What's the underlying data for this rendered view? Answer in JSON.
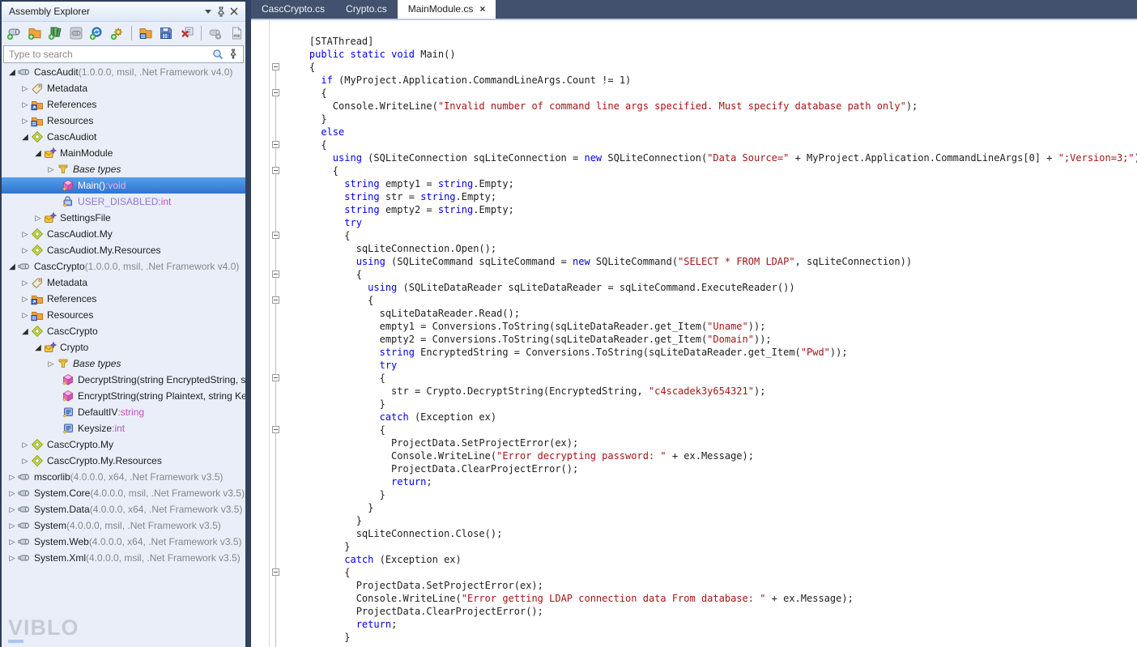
{
  "explorer": {
    "title": "Assembly Explorer",
    "title_buttons": [
      {
        "name": "panel-menu-button",
        "icon": "chevron-down-icon"
      },
      {
        "name": "panel-pin-button",
        "icon": "pin-icon"
      },
      {
        "name": "panel-close-button",
        "icon": "close-icon"
      }
    ],
    "toolbar": [
      {
        "name": "open-assembly-button",
        "icon": "assembly-add-icon"
      },
      {
        "name": "open-folder-button",
        "icon": "folder-add-icon"
      },
      {
        "name": "open-list-button",
        "icon": "list-add-icon"
      },
      {
        "name": "open-from-gac-button",
        "icon": "gac-icon"
      },
      {
        "name": "reload-assemblies-button",
        "icon": "reload-add-icon"
      },
      {
        "name": "open-dynamic-button",
        "icon": "gear-add-icon"
      },
      {
        "sep": true
      },
      {
        "name": "open-module-button",
        "icon": "module-folder-icon"
      },
      {
        "name": "save-module-button",
        "icon": "save-module-icon"
      },
      {
        "name": "close-file-button",
        "icon": "close-file-icon"
      },
      {
        "sep": true
      },
      {
        "name": "disable-mma-button",
        "icon": "assembly-gear-icon"
      },
      {
        "name": "open-pdb-button",
        "icon": "pdb-file-icon"
      }
    ],
    "search": {
      "placeholder": "Type to search",
      "icons": [
        "search-icon",
        "search-pin-icon"
      ]
    },
    "tree": [
      {
        "level": 0,
        "exp": "open",
        "icon": "assembly-icon",
        "segs": [
          [
            "",
            "CascAudit "
          ],
          [
            "gray",
            "(1.0.0.0, msil, .Net Framework v4.0)"
          ]
        ]
      },
      {
        "level": 1,
        "exp": "closed",
        "icon": "tag-icon",
        "segs": [
          [
            "",
            "Metadata"
          ]
        ]
      },
      {
        "level": 1,
        "exp": "closed",
        "icon": "references-icon",
        "segs": [
          [
            "",
            "References"
          ]
        ]
      },
      {
        "level": 1,
        "exp": "closed",
        "icon": "resources-icon",
        "segs": [
          [
            "",
            "Resources"
          ]
        ]
      },
      {
        "level": 1,
        "exp": "open",
        "icon": "namespace-icon",
        "segs": [
          [
            "",
            "CascAudiot"
          ]
        ]
      },
      {
        "level": 2,
        "exp": "open",
        "icon": "class-icon",
        "segs": [
          [
            "",
            "MainModule"
          ]
        ]
      },
      {
        "level": 3,
        "exp": "closed",
        "icon": "basetypes-icon",
        "segs": [
          [
            "it",
            "Base types"
          ]
        ]
      },
      {
        "level": 3,
        "exp": "none",
        "icon": "method-icon",
        "sel": true,
        "segs": [
          [
            "",
            "Main()"
          ],
          [
            "pink",
            ":void"
          ]
        ]
      },
      {
        "level": 3,
        "exp": "none",
        "icon": "field-icon",
        "segs": [
          [
            "violet",
            "USER_DISABLED"
          ],
          [
            "magenta",
            ":int"
          ]
        ]
      },
      {
        "level": 2,
        "exp": "closed",
        "icon": "class-icon",
        "segs": [
          [
            "",
            "SettingsFile"
          ]
        ]
      },
      {
        "level": 1,
        "exp": "closed",
        "icon": "namespace-icon",
        "segs": [
          [
            "",
            "CascAudiot.My"
          ]
        ]
      },
      {
        "level": 1,
        "exp": "closed",
        "icon": "namespace-icon",
        "segs": [
          [
            "",
            "CascAudiot.My.Resources"
          ]
        ]
      },
      {
        "level": 0,
        "exp": "open",
        "icon": "assembly-icon",
        "segs": [
          [
            "",
            "CascCrypto "
          ],
          [
            "gray",
            "(1.0.0.0, msil, .Net Framework v4.0)"
          ]
        ]
      },
      {
        "level": 1,
        "exp": "closed",
        "icon": "tag-icon",
        "segs": [
          [
            "",
            "Metadata"
          ]
        ]
      },
      {
        "level": 1,
        "exp": "closed",
        "icon": "references-icon",
        "segs": [
          [
            "",
            "References"
          ]
        ]
      },
      {
        "level": 1,
        "exp": "closed",
        "icon": "resources-icon",
        "segs": [
          [
            "",
            "Resources"
          ]
        ]
      },
      {
        "level": 1,
        "exp": "open",
        "icon": "namespace-icon",
        "segs": [
          [
            "",
            "CascCrypto"
          ]
        ]
      },
      {
        "level": 2,
        "exp": "open",
        "icon": "class-icon",
        "segs": [
          [
            "",
            "Crypto"
          ]
        ]
      },
      {
        "level": 3,
        "exp": "closed",
        "icon": "basetypes-icon",
        "segs": [
          [
            "it",
            "Base types"
          ]
        ]
      },
      {
        "level": 3,
        "exp": "none",
        "icon": "method-icon",
        "segs": [
          [
            "",
            "DecryptString(string EncryptedString, str"
          ]
        ]
      },
      {
        "level": 3,
        "exp": "none",
        "icon": "method-icon",
        "segs": [
          [
            "",
            "EncryptString(string Plaintext, string Key"
          ]
        ]
      },
      {
        "level": 3,
        "exp": "none",
        "icon": "property-icon",
        "segs": [
          [
            "",
            "DefaultIV"
          ],
          [
            "magenta",
            ":string"
          ]
        ]
      },
      {
        "level": 3,
        "exp": "none",
        "icon": "property-icon",
        "segs": [
          [
            "",
            "Keysize"
          ],
          [
            "magenta",
            ":int"
          ]
        ]
      },
      {
        "level": 1,
        "exp": "closed",
        "icon": "namespace-icon",
        "segs": [
          [
            "",
            "CascCrypto.My"
          ]
        ]
      },
      {
        "level": 1,
        "exp": "closed",
        "icon": "namespace-icon",
        "segs": [
          [
            "",
            "CascCrypto.My.Resources"
          ]
        ]
      },
      {
        "level": 0,
        "exp": "closed",
        "icon": "assembly-icon",
        "segs": [
          [
            "",
            "mscorlib "
          ],
          [
            "gray",
            "(4.0.0.0, x64, .Net Framework v3.5)"
          ]
        ]
      },
      {
        "level": 0,
        "exp": "closed",
        "icon": "assembly-icon",
        "segs": [
          [
            "",
            "System.Core "
          ],
          [
            "gray",
            "(4.0.0.0, msil, .Net Framework v3.5)"
          ]
        ]
      },
      {
        "level": 0,
        "exp": "closed",
        "icon": "assembly-icon",
        "segs": [
          [
            "",
            "System.Data "
          ],
          [
            "gray",
            "(4.0.0.0, x64, .Net Framework v3.5)"
          ]
        ]
      },
      {
        "level": 0,
        "exp": "closed",
        "icon": "assembly-icon",
        "segs": [
          [
            "",
            "System "
          ],
          [
            "gray",
            "(4.0.0.0, msil, .Net Framework v3.5)"
          ]
        ]
      },
      {
        "level": 0,
        "exp": "closed",
        "icon": "assembly-icon",
        "segs": [
          [
            "",
            "System.Web "
          ],
          [
            "gray",
            "(4.0.0.0, x64, .Net Framework v3.5)"
          ]
        ]
      },
      {
        "level": 0,
        "exp": "closed",
        "icon": "assembly-icon",
        "segs": [
          [
            "",
            "System.Xml "
          ],
          [
            "gray",
            "(4.0.0.0, msil, .Net Framework v3.5)"
          ]
        ]
      }
    ],
    "watermark": {
      "first_letter": "V",
      "rest": "IBLO"
    }
  },
  "editor": {
    "tabs": [
      {
        "label": "CascCrypto.cs",
        "active": false
      },
      {
        "label": "Crypto.cs",
        "active": false
      },
      {
        "label": "MainModule.cs",
        "active": true,
        "close": "×"
      }
    ],
    "fold_lines": [
      3,
      5,
      9,
      11,
      16,
      19,
      21,
      27,
      31,
      42
    ],
    "code_lines": [
      [
        [
          "p",
          "    [STAThread]"
        ]
      ],
      [
        [
          "p",
          "    "
        ],
        [
          "k",
          "public"
        ],
        [
          "p",
          " "
        ],
        [
          "k",
          "static"
        ],
        [
          "p",
          " "
        ],
        [
          "k",
          "void"
        ],
        [
          "p",
          " Main()"
        ]
      ],
      [
        [
          "p",
          "    {"
        ]
      ],
      [
        [
          "p",
          "      "
        ],
        [
          "k",
          "if"
        ],
        [
          "p",
          " (MyProject.Application.CommandLineArgs.Count != 1)"
        ]
      ],
      [
        [
          "p",
          "      {"
        ]
      ],
      [
        [
          "p",
          "        Console.WriteLine("
        ],
        [
          "s",
          "\"Invalid number of command line args specified. Must specify database path only\""
        ],
        [
          "p",
          ");"
        ]
      ],
      [
        [
          "p",
          "      }"
        ]
      ],
      [
        [
          "p",
          "      "
        ],
        [
          "k",
          "else"
        ]
      ],
      [
        [
          "p",
          "      {"
        ]
      ],
      [
        [
          "p",
          "        "
        ],
        [
          "k",
          "using"
        ],
        [
          "p",
          " (SQLiteConnection sqLiteConnection = "
        ],
        [
          "k",
          "new"
        ],
        [
          "p",
          " SQLiteConnection("
        ],
        [
          "s",
          "\"Data Source=\""
        ],
        [
          "p",
          " + MyProject.Application.CommandLineArgs[0] + "
        ],
        [
          "s",
          "\";Version=3;\""
        ],
        [
          "p",
          "))"
        ]
      ],
      [
        [
          "p",
          "        {"
        ]
      ],
      [
        [
          "p",
          "          "
        ],
        [
          "k",
          "string"
        ],
        [
          "p",
          " empty1 = "
        ],
        [
          "k",
          "string"
        ],
        [
          "p",
          ".Empty;"
        ]
      ],
      [
        [
          "p",
          "          "
        ],
        [
          "k",
          "string"
        ],
        [
          "p",
          " str = "
        ],
        [
          "k",
          "string"
        ],
        [
          "p",
          ".Empty;"
        ]
      ],
      [
        [
          "p",
          "          "
        ],
        [
          "k",
          "string"
        ],
        [
          "p",
          " empty2 = "
        ],
        [
          "k",
          "string"
        ],
        [
          "p",
          ".Empty;"
        ]
      ],
      [
        [
          "p",
          "          "
        ],
        [
          "k",
          "try"
        ]
      ],
      [
        [
          "p",
          "          {"
        ]
      ],
      [
        [
          "p",
          "            sqLiteConnection.Open();"
        ]
      ],
      [
        [
          "p",
          "            "
        ],
        [
          "k",
          "using"
        ],
        [
          "p",
          " (SQLiteCommand sqLiteCommand = "
        ],
        [
          "k",
          "new"
        ],
        [
          "p",
          " SQLiteCommand("
        ],
        [
          "s",
          "\"SELECT * FROM LDAP\""
        ],
        [
          "p",
          ", sqLiteConnection))"
        ]
      ],
      [
        [
          "p",
          "            {"
        ]
      ],
      [
        [
          "p",
          "              "
        ],
        [
          "k",
          "using"
        ],
        [
          "p",
          " (SQLiteDataReader sqLiteDataReader = sqLiteCommand.ExecuteReader())"
        ]
      ],
      [
        [
          "p",
          "              {"
        ]
      ],
      [
        [
          "p",
          "                sqLiteDataReader.Read();"
        ]
      ],
      [
        [
          "p",
          "                empty1 = Conversions.ToString(sqLiteDataReader.get_Item("
        ],
        [
          "s",
          "\"Uname\""
        ],
        [
          "p",
          "));"
        ]
      ],
      [
        [
          "p",
          "                empty2 = Conversions.ToString(sqLiteDataReader.get_Item("
        ],
        [
          "s",
          "\"Domain\""
        ],
        [
          "p",
          "));"
        ]
      ],
      [
        [
          "p",
          "                "
        ],
        [
          "k",
          "string"
        ],
        [
          "p",
          " EncryptedString = Conversions.ToString(sqLiteDataReader.get_Item("
        ],
        [
          "s",
          "\"Pwd\""
        ],
        [
          "p",
          "));"
        ]
      ],
      [
        [
          "p",
          "                "
        ],
        [
          "k",
          "try"
        ]
      ],
      [
        [
          "p",
          "                {"
        ]
      ],
      [
        [
          "p",
          "                  str = Crypto.DecryptString(EncryptedString, "
        ],
        [
          "s",
          "\"c4scadek3y654321\""
        ],
        [
          "p",
          ");"
        ]
      ],
      [
        [
          "p",
          "                }"
        ]
      ],
      [
        [
          "p",
          "                "
        ],
        [
          "k",
          "catch"
        ],
        [
          "p",
          " (Exception ex)"
        ]
      ],
      [
        [
          "p",
          "                {"
        ]
      ],
      [
        [
          "p",
          "                  ProjectData.SetProjectError(ex);"
        ]
      ],
      [
        [
          "p",
          "                  Console.WriteLine("
        ],
        [
          "s",
          "\"Error decrypting password: \""
        ],
        [
          "p",
          " + ex.Message);"
        ]
      ],
      [
        [
          "p",
          "                  ProjectData.ClearProjectError();"
        ]
      ],
      [
        [
          "p",
          "                  "
        ],
        [
          "k",
          "return"
        ],
        [
          "p",
          ";"
        ]
      ],
      [
        [
          "p",
          "                }"
        ]
      ],
      [
        [
          "p",
          "              }"
        ]
      ],
      [
        [
          "p",
          "            }"
        ]
      ],
      [
        [
          "p",
          "            sqLiteConnection.Close();"
        ]
      ],
      [
        [
          "p",
          "          }"
        ]
      ],
      [
        [
          "p",
          "          "
        ],
        [
          "k",
          "catch"
        ],
        [
          "p",
          " (Exception ex)"
        ]
      ],
      [
        [
          "p",
          "          {"
        ]
      ],
      [
        [
          "p",
          "            ProjectData.SetProjectError(ex);"
        ]
      ],
      [
        [
          "p",
          "            Console.WriteLine("
        ],
        [
          "s",
          "\"Error getting LDAP connection data From database: \""
        ],
        [
          "p",
          " + ex.Message);"
        ]
      ],
      [
        [
          "p",
          "            ProjectData.ClearProjectError();"
        ]
      ],
      [
        [
          "p",
          "            "
        ],
        [
          "k",
          "return"
        ],
        [
          "p",
          ";"
        ]
      ],
      [
        [
          "p",
          "          }"
        ]
      ]
    ]
  },
  "colors": {
    "panel_bg": "#E9EEF8",
    "frame": "#2E3D5C",
    "tabstrip": "#42516D",
    "selection_top": "#55A0EA",
    "selection_bottom": "#3173D1",
    "keyword": "#0000E6",
    "string": "#A31515",
    "meta_gray": "#878787",
    "field_violet": "#8E79D4",
    "type_magenta": "#C04FC0",
    "sel_type_pink": "#F5A8E0"
  }
}
